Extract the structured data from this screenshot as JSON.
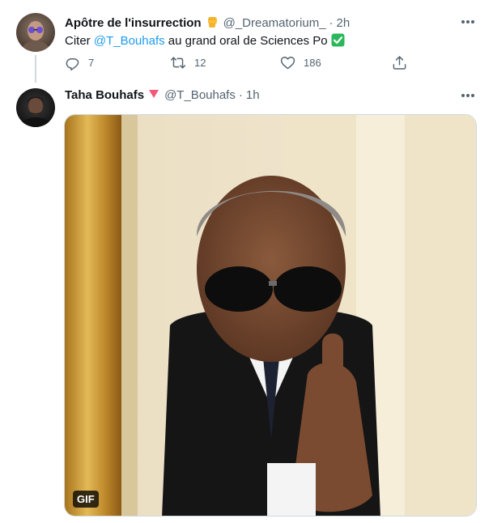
{
  "tweets": [
    {
      "author_name": "Apôtre de l'insurrection",
      "handle": "@_Dreamatorium_",
      "time": "2h",
      "text_prefix": "Citer ",
      "mention": "@T_Bouhafs",
      "text_suffix": " au grand oral de Sciences Po ",
      "replies": "7",
      "retweets": "12",
      "likes": "186"
    },
    {
      "author_name": "Taha Bouhafs",
      "handle": "@T_Bouhafs",
      "time": "1h",
      "media_badge": "GIF"
    }
  ],
  "icons": {
    "name_badge_1": "raised-fist-icon",
    "checkmark": "check-mark-button-icon",
    "name_badge_2": "red-triangle-icon",
    "reply": "reply-icon",
    "retweet": "retweet-icon",
    "like": "heart-icon",
    "share": "share-icon",
    "more": "more-icon"
  },
  "colors": {
    "accent": "#1d9bf0",
    "muted": "#536471",
    "check_green": "#2bb75a",
    "triangle_red": "#f2567a"
  }
}
